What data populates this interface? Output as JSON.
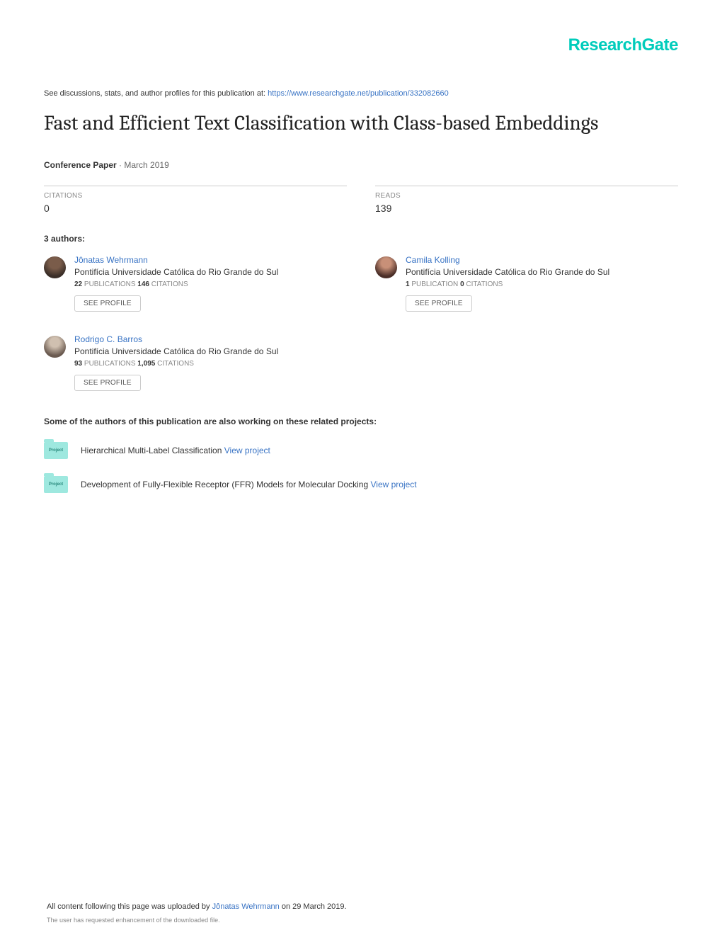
{
  "brand": "ResearchGate",
  "discussions_prefix": "See discussions, stats, and author profiles for this publication at: ",
  "discussions_link": "https://www.researchgate.net/publication/332082660",
  "title": "Fast and Efficient Text Classification with Class-based Embeddings",
  "pubtype": "Conference Paper",
  "pubdate": " · March 2019",
  "stats": {
    "citations_label": "CITATIONS",
    "citations_value": "0",
    "reads_label": "READS",
    "reads_value": "139"
  },
  "authors_header": "3 authors:",
  "authors": [
    {
      "name": "Jônatas Wehrmann",
      "affil": "Pontifícia Universidade Católica do Rio Grande do Sul",
      "pubs_n": "22",
      "pubs_l": " PUBLICATIONS   ",
      "cits_n": "146",
      "cits_l": " CITATIONS",
      "btn": "SEE PROFILE"
    },
    {
      "name": "Camila Kolling",
      "affil": "Pontifícia Universidade Católica do Rio Grande do Sul",
      "pubs_n": "1",
      "pubs_l": " PUBLICATION   ",
      "cits_n": "0",
      "cits_l": " CITATIONS",
      "btn": "SEE PROFILE"
    },
    {
      "name": "Rodrigo C. Barros",
      "affil": "Pontifícia Universidade Católica do Rio Grande do Sul",
      "pubs_n": "93",
      "pubs_l": " PUBLICATIONS   ",
      "cits_n": "1,095",
      "cits_l": " CITATIONS",
      "btn": "SEE PROFILE"
    }
  ],
  "related_header": "Some of the authors of this publication are also working on these related projects:",
  "projects": [
    {
      "title": "Hierarchical Multi-Label Classification ",
      "link": "View project"
    },
    {
      "title": "Development of Fully-Flexible Receptor (FFR) Models for Molecular Docking ",
      "link": "View project"
    }
  ],
  "footer": {
    "prefix": "All content following this page was uploaded by ",
    "uploader": "Jônatas Wehrmann",
    "suffix": " on 29 March 2019.",
    "note": "The user has requested enhancement of the downloaded file."
  }
}
